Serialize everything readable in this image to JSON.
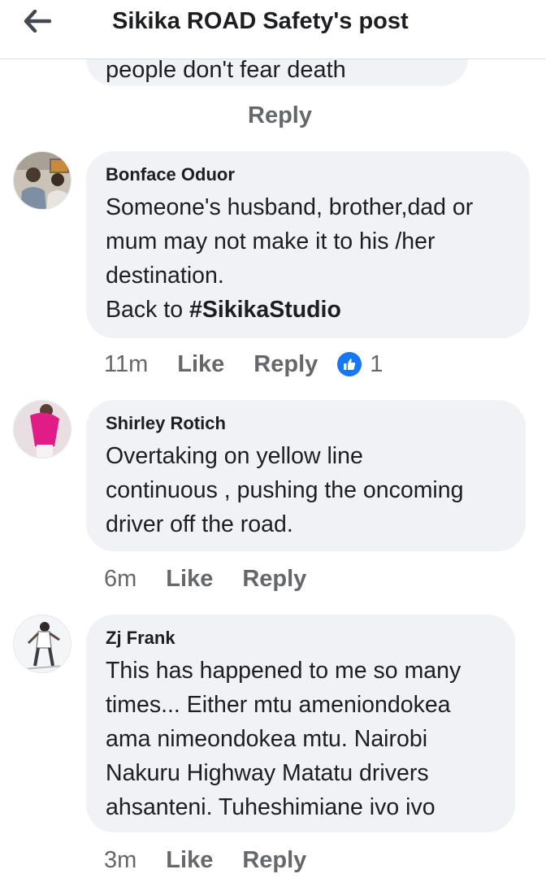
{
  "header": {
    "title": "Sikika ROAD Safety's post"
  },
  "partial_comment": {
    "text": "people don't fear death",
    "reply_label": "Reply"
  },
  "comments": [
    {
      "author": "Bonface Oduor",
      "lines": [
        "Someone's husband, brother,dad or",
        "mum may not make it to his /her",
        "destination."
      ],
      "last_line_prefix": "Back to ",
      "hashtag": "#SikikaStudio",
      "time": "11m",
      "like_label": "Like",
      "reply_label": "Reply",
      "reaction_count": "1",
      "reaction_icon": "thumbs-up-icon"
    },
    {
      "author": "Shirley Rotich",
      "lines": [
        "Overtaking on yellow line",
        "continuous , pushing the oncoming",
        "driver off the road."
      ],
      "time": "6m",
      "like_label": "Like",
      "reply_label": "Reply"
    },
    {
      "author": "Zj Frank",
      "lines": [
        "This has happened to me so many",
        "times... Either mtu ameniondokea",
        "ama nimeondokea mtu. Nairobi",
        "Nakuru Highway Matatu drivers",
        "ahsanteni. Tuheshimiane ivo ivo"
      ],
      "time": "3m",
      "like_label": "Like",
      "reply_label": "Reply"
    }
  ],
  "colors": {
    "bubble": "#f0f2f5",
    "secondary_text": "#65676b",
    "primary_text": "#1c1e21",
    "like_blue": "#1877f2"
  }
}
